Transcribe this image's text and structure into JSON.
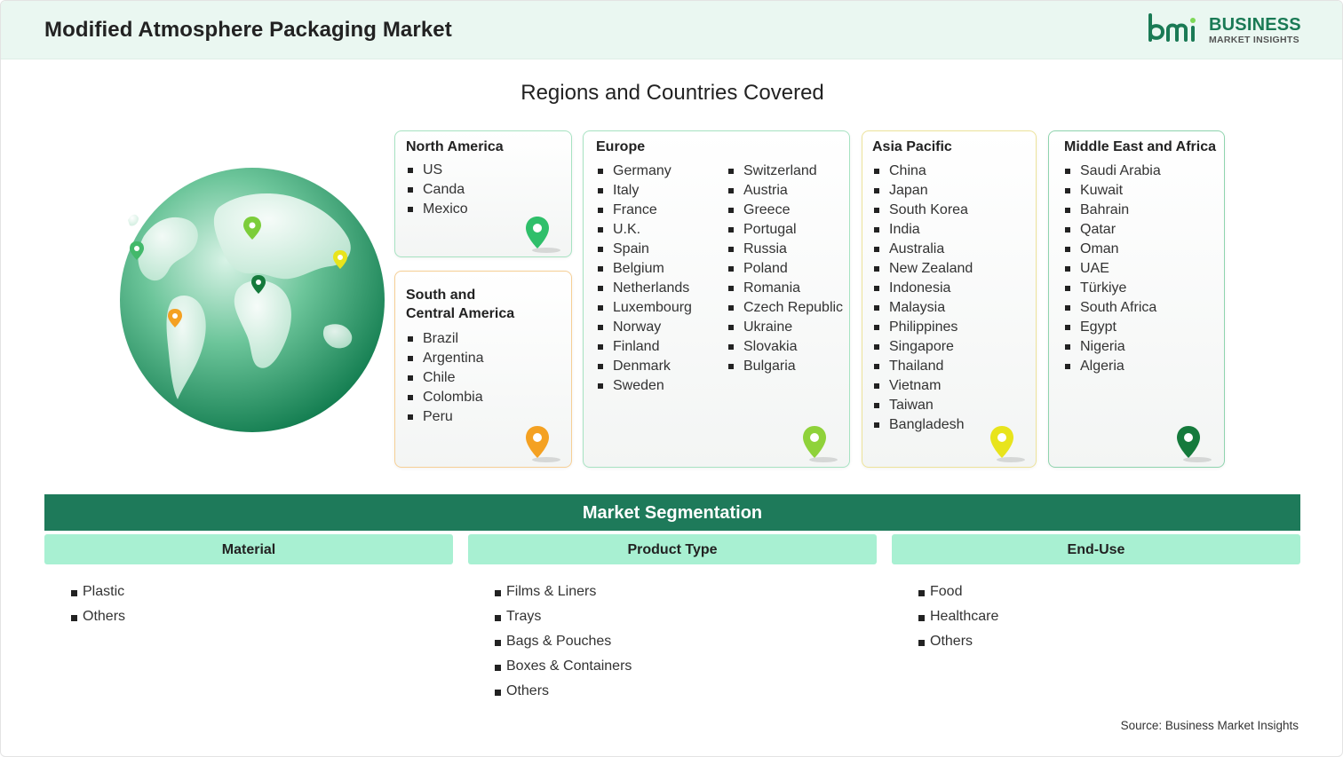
{
  "header": {
    "title": "Modified Atmosphere Packaging Market",
    "logo_line1": "BUSINESS",
    "logo_line2": "MARKET INSIGHTS"
  },
  "regions": {
    "title": "Regions and Countries Covered",
    "north_america": {
      "name": "North America",
      "pin_color": "#2fbf6a",
      "countries": [
        "US",
        "Canda",
        "Mexico"
      ]
    },
    "south_central_america": {
      "name_line1": "South and",
      "name_line2": "Central America",
      "pin_color": "#f4a122",
      "countries": [
        "Brazil",
        "Argentina",
        "Chile",
        "Colombia",
        "Peru"
      ]
    },
    "europe": {
      "name": "Europe",
      "pin_color": "#8fd23a",
      "countries_col1": [
        "Germany",
        "Italy",
        "France",
        "U.K.",
        "Spain",
        "Belgium",
        "Netherlands",
        "Luxembourg",
        "Norway",
        "Finland",
        "Denmark",
        "Sweden"
      ],
      "countries_col2": [
        "Switzerland",
        "Austria",
        "Greece",
        "Portugal",
        "Russia",
        "Poland",
        "Romania",
        "Czech Republic",
        "Ukraine",
        "Slovakia",
        "Bulgaria"
      ]
    },
    "asia_pacific": {
      "name": "Asia Pacific",
      "pin_color": "#e8e41c",
      "countries": [
        "China",
        "Japan",
        "South Korea",
        "India",
        "Australia",
        "New Zealand",
        "Indonesia",
        "Malaysia",
        "Philippines",
        "Singapore",
        "Thailand",
        "Vietnam",
        "Taiwan",
        "Bangladesh"
      ]
    },
    "middle_east_africa": {
      "name": "Middle East and Africa",
      "pin_color": "#157a3c",
      "countries": [
        "Saudi Arabia",
        "Kuwait",
        "Bahrain",
        "Qatar",
        "Oman",
        "UAE",
        "Türkiye",
        "South Africa",
        "Egypt",
        "Nigeria",
        "Algeria"
      ]
    }
  },
  "segmentation": {
    "title": "Market Segmentation",
    "material": {
      "label": "Material",
      "items": [
        "Plastic",
        "Others"
      ]
    },
    "product_type": {
      "label": "Product Type",
      "items": [
        "Films & Liners",
        "Trays",
        "Bags & Pouches",
        "Boxes & Containers",
        "Others"
      ]
    },
    "end_use": {
      "label": "End-Use",
      "items": [
        "Food",
        "Healthcare",
        "Others"
      ]
    }
  },
  "source": "Source: Business Market Insights",
  "colors": {
    "header_bg": "#eaf7f1",
    "brand_green": "#1e7a5a",
    "segment_header": "#a8f0d2"
  }
}
